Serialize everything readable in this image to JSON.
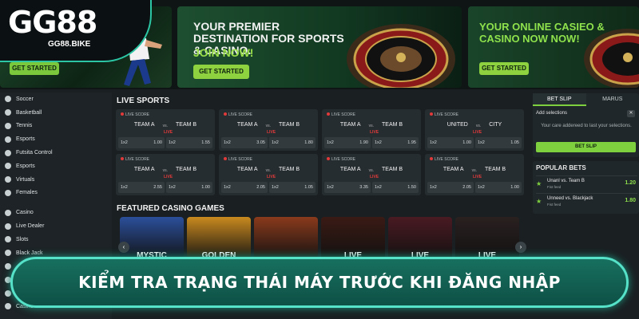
{
  "logo": {
    "brand": "GG88",
    "domain": "GG88.BIKE"
  },
  "banners": [
    {
      "cta": "GET STARTED"
    },
    {
      "headline": "YOUR PREMIER DESTINATION FOR SPORTS & CASINO.",
      "sub": "JOIN NOW!",
      "cta": "GET STARTED"
    },
    {
      "headline": "YOUR ONLINE CASIEO & CASINO NOW NOW!",
      "cta": "GET STARTED"
    }
  ],
  "sidebar": {
    "items": [
      {
        "label": "Soccer",
        "icon": "soccer-ball-icon"
      },
      {
        "label": "Basketball",
        "icon": "basketball-icon"
      },
      {
        "label": "Tennis",
        "icon": "tennis-icon"
      },
      {
        "label": "Esports",
        "icon": "controller-icon"
      },
      {
        "label": "Futsita Control",
        "icon": "football-icon"
      },
      {
        "label": "Esports",
        "icon": "gamepad-icon"
      },
      {
        "label": "Virtuals",
        "icon": "virtual-icon"
      },
      {
        "label": "Females",
        "icon": "user-icon"
      },
      {
        "label": "Casino",
        "icon": "casino-icon"
      },
      {
        "label": "Live Dealer",
        "icon": "dealer-icon"
      },
      {
        "label": "Slots",
        "icon": "slots-icon"
      },
      {
        "label": "Black Jack",
        "icon": "cards-icon"
      },
      {
        "label": "",
        "icon": "chip-icon"
      },
      {
        "label": "",
        "icon": "chip-icon"
      },
      {
        "label": "",
        "icon": "chip-icon"
      },
      {
        "label": "Casino",
        "icon": "casino-icon"
      }
    ]
  },
  "live_sports": {
    "title": "LIVE SPORTS",
    "matches": [
      {
        "label": "LIVE SCORE",
        "home": "TEAM A",
        "away": "TEAM B",
        "live": "LIVE",
        "odds": [
          [
            "1x2",
            "1.00"
          ],
          [
            "1x2",
            "1.55"
          ]
        ]
      },
      {
        "label": "LIVE SCORE",
        "home": "TEAM A",
        "away": "TEAM B",
        "live": "LIVE",
        "odds": [
          [
            "1x2",
            "3.05"
          ],
          [
            "1x2",
            "1.80"
          ]
        ]
      },
      {
        "label": "LIVE SCORE",
        "home": "TEAM A",
        "away": "TEAM B",
        "live": "LIVE",
        "odds": [
          [
            "1x2",
            "1.90"
          ],
          [
            "1x2",
            "1.95"
          ]
        ]
      },
      {
        "label": "LIVE SCORE",
        "home": "UNITED",
        "away": "CITY",
        "live": "LIVE",
        "odds": [
          [
            "1x2",
            "1.00"
          ],
          [
            "1x2",
            "1.05"
          ]
        ]
      },
      {
        "label": "LIVE SCORE",
        "home": "TEAM A",
        "away": "TEAM B",
        "live": "LIVE",
        "odds": [
          [
            "1x2",
            "2.55"
          ],
          [
            "1x2",
            "1.00"
          ]
        ]
      },
      {
        "label": "LIVE SCORE",
        "home": "TEAM A",
        "away": "TEAM B",
        "live": "LIVE",
        "odds": [
          [
            "1x2",
            "2.05"
          ],
          [
            "1x2",
            "1.05"
          ]
        ]
      },
      {
        "label": "LIVE SCORE",
        "home": "TEAM A",
        "away": "TEAM B",
        "live": "LIVE",
        "odds": [
          [
            "1x2",
            "3.35"
          ],
          [
            "1x2",
            "1.50"
          ]
        ]
      },
      {
        "label": "LIVE SCORE",
        "home": "TEAM A",
        "away": "TEAM B",
        "live": "LIVE",
        "odds": [
          [
            "1x2",
            "2.05"
          ],
          [
            "1x2",
            "1.00"
          ]
        ]
      }
    ]
  },
  "casino": {
    "title": "FEATURED CASINO GAMES",
    "games": [
      {
        "name": "MYSTIC",
        "color": "#2b4f9a"
      },
      {
        "name": "GOLDEN",
        "color": "#c98a1f"
      },
      {
        "name": "",
        "color": "#8a3a1c"
      },
      {
        "name": "LIVE",
        "color": "#3a1a14"
      },
      {
        "name": "LIVE",
        "color": "#4a1a22"
      },
      {
        "name": "LIVE",
        "color": "#2a2020"
      }
    ]
  },
  "bet_slip": {
    "tabs": [
      "BET SLIP",
      "MARUS"
    ],
    "add_selections": "Add selections",
    "message": "Your care addereed to last your selections.",
    "button": "BET SLIP"
  },
  "popular_bets": {
    "title": "POPULAR BETS",
    "rows": [
      {
        "match": "Unanl vs. Team B",
        "sub": "Fist feed",
        "odd": "1.20"
      },
      {
        "match": "Unneed vs. Blackjack",
        "sub": "Fist feed",
        "odd": "1.80"
      }
    ]
  },
  "ribbon": {
    "text": "KIỂM TRA TRẠNG THÁI MÁY TRƯỚC KHI ĐĂNG NHẬP"
  },
  "colors": {
    "accent": "#7fd03f",
    "teal": "#55e2c8",
    "live": "#e23a3a"
  }
}
